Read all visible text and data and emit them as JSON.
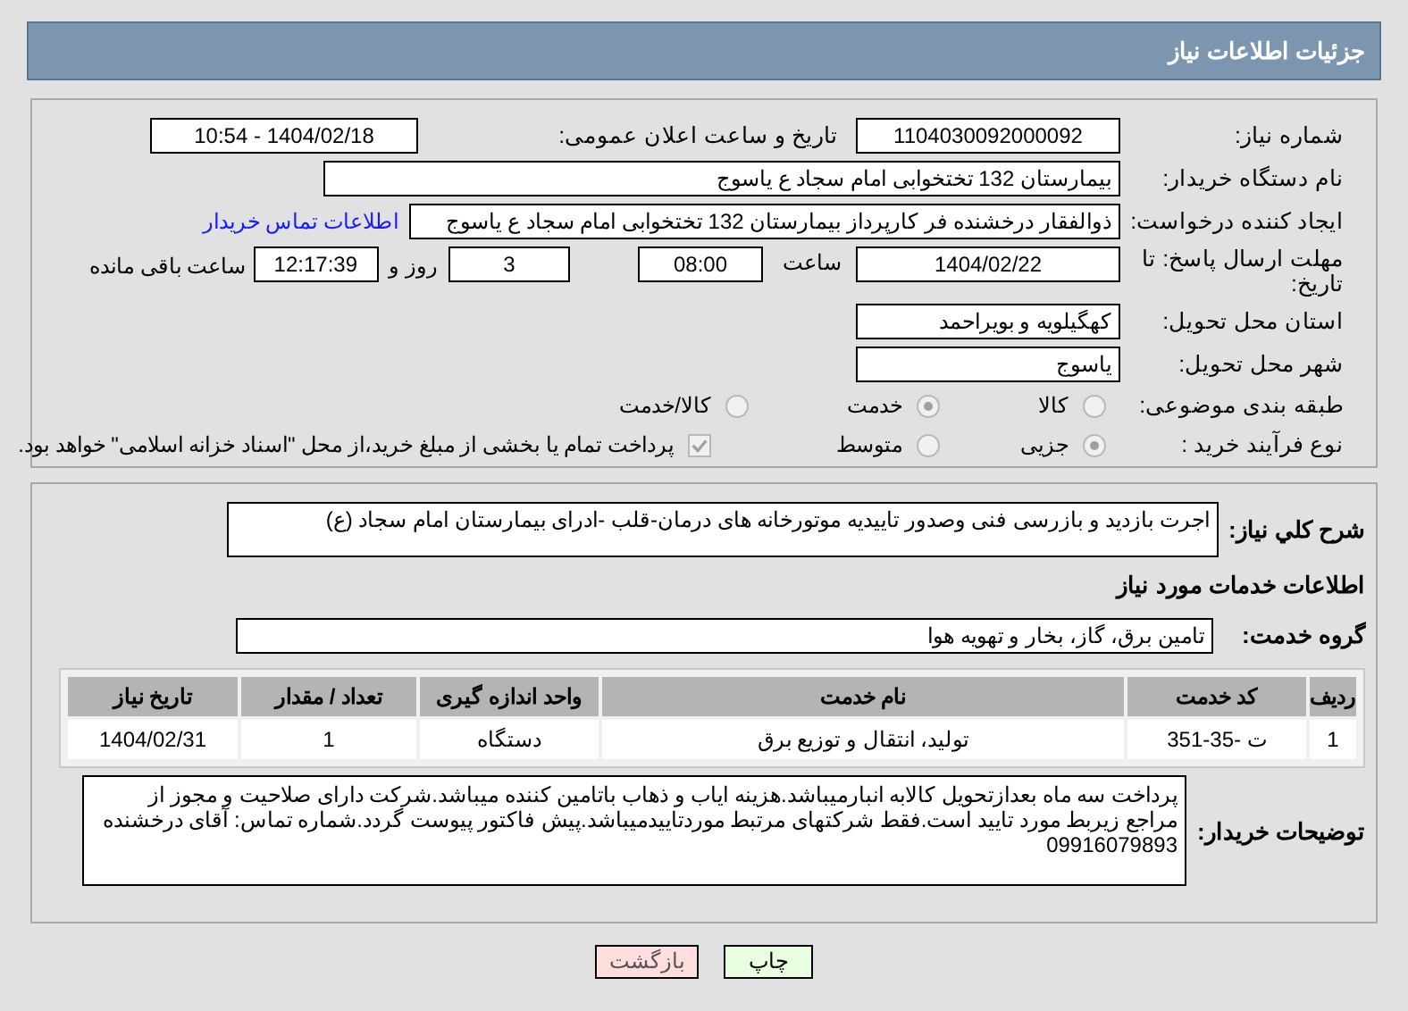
{
  "header": {
    "title": "جزئیات اطلاعات نیاز"
  },
  "details": {
    "need_number": {
      "label": "شماره نیاز:",
      "value": "1104030092000092"
    },
    "announce": {
      "label": "تاریخ و ساعت اعلان عمومی:",
      "value": "1404/02/18 - 10:54"
    },
    "buyer": {
      "label": "نام دستگاه خریدار:",
      "value": "بیمارستان 132 تختخوابی امام سجاد  ع  یاسوج"
    },
    "creator": {
      "label": "ایجاد کننده درخواست:",
      "value": "ذوالفقار درخشنده فر کارپرداز بیمارستان 132 تختخوابی امام سجاد  ع  یاسوج",
      "link": "اطلاعات تماس خریدار"
    },
    "deadline": {
      "label": "مهلت ارسال پاسخ: تا تاریخ:",
      "date": "1404/02/22",
      "time_label": "ساعت",
      "time": "08:00",
      "days": "3",
      "days_label": "روز و",
      "remaining": "12:17:39",
      "remaining_label": "ساعت باقی مانده"
    },
    "province": {
      "label": "استان محل تحویل:",
      "value": "کهگیلویه و بویراحمد"
    },
    "city": {
      "label": "شهر محل تحویل:",
      "value": "یاسوج"
    },
    "category": {
      "label": "طبقه بندی موضوعی:",
      "options": [
        {
          "label": "کالا",
          "selected": false
        },
        {
          "label": "خدمت",
          "selected": true
        },
        {
          "label": "کالا/خدمت",
          "selected": false
        }
      ]
    },
    "process": {
      "label": "نوع فرآیند خرید :",
      "options": [
        {
          "label": "جزیی",
          "selected": true
        },
        {
          "label": "متوسط",
          "selected": false
        }
      ],
      "payment": {
        "label": "پرداخت تمام یا بخشی از مبلغ خرید،از محل \"اسناد خزانه اسلامی\" خواهد بود.",
        "checked": true
      }
    }
  },
  "services": {
    "summary": {
      "label": "شرح کلي نياز:",
      "value": "اجرت بازدید و بازرسی فنی وصدور تاییدیه موتورخانه های درمان-قلب -ادرای بیمارستان امام سجاد (ع)"
    },
    "heading": "اطلاعات خدمات مورد نیاز",
    "group": {
      "label": "گروه خدمت:",
      "value": "تامین برق، گاز، بخار و تهویه هوا"
    },
    "table": {
      "columns": [
        "ردیف",
        "کد خدمت",
        "نام خدمت",
        "واحد اندازه گیری",
        "تعداد / مقدار",
        "تاریخ نیاز"
      ],
      "rows": [
        [
          "1",
          "ت -35-351",
          "تولید، انتقال و توزیع برق",
          "دستگاه",
          "1",
          "1404/02/31"
        ]
      ]
    },
    "notes": {
      "label": "توضیحات خریدار:",
      "value": "پرداخت سه  ماه بعدازتحویل کالابه انبارمیباشد.هزینه ایاب و ذهاب باتامین کننده میباشد.شرکت دارای صلاحیت و مجوز از مراجع زیربط مورد تایید است.فقط شرکتهای مرتبط موردتاییدمیباشد.پیش فاکتور پیوست گردد.شماره تماس: آقای درخشنده 09916079893"
    }
  },
  "buttons": [
    {
      "label": "چاپ",
      "kind": "print"
    },
    {
      "label": "بازگشت",
      "kind": "back"
    }
  ]
}
